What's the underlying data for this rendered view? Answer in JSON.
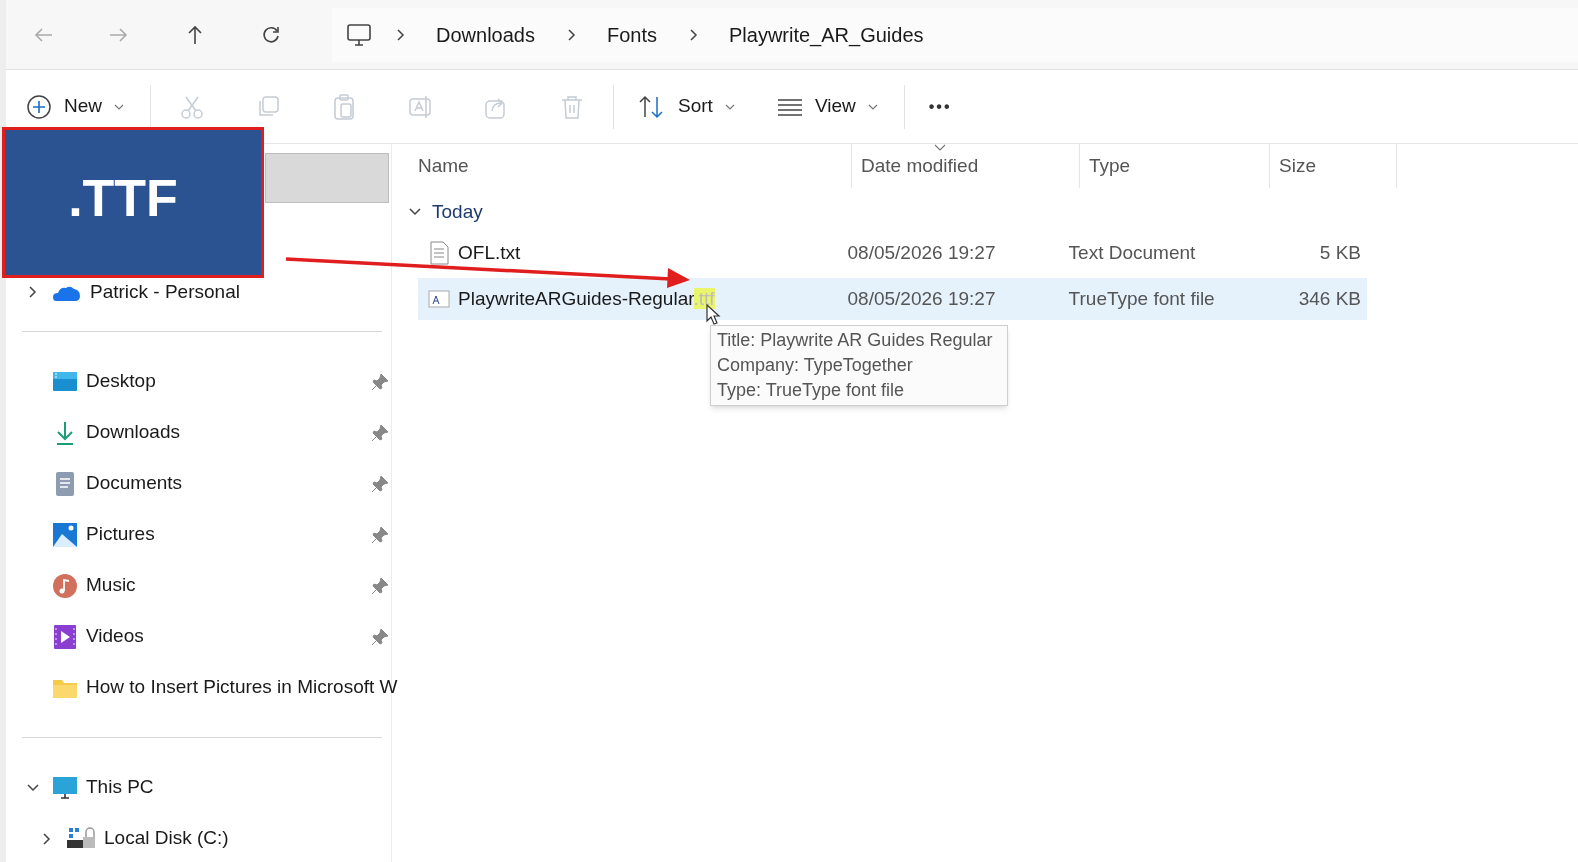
{
  "breadcrumb": [
    "Downloads",
    "Fonts",
    "Playwrite_AR_Guides"
  ],
  "toolbar": {
    "new_label": "New",
    "sort_label": "Sort",
    "view_label": "View",
    "more_label": "•••"
  },
  "overlay_label": ".TTF",
  "sidebar": {
    "account": {
      "label": "Patrick - Personal",
      "expanded": false
    },
    "quick_access": [
      {
        "label": "Desktop",
        "pinned": true
      },
      {
        "label": "Downloads",
        "pinned": true
      },
      {
        "label": "Documents",
        "pinned": true
      },
      {
        "label": "Pictures",
        "pinned": true
      },
      {
        "label": "Music",
        "pinned": true
      },
      {
        "label": "Videos",
        "pinned": true
      },
      {
        "label": "How to Insert Pictures in Microsoft W",
        "pinned": false
      }
    ],
    "this_pc": {
      "label": "This PC",
      "expanded": true,
      "children": [
        {
          "label": "Local Disk (C:)",
          "expanded": false
        }
      ]
    }
  },
  "table": {
    "columns": [
      "Name",
      "Date modified",
      "Type",
      "Size"
    ],
    "group": {
      "label": "Today",
      "expanded": true
    },
    "rows": [
      {
        "name": "OFL.txt",
        "extension": "",
        "kind": "text",
        "date": "08/05/2026 19:27",
        "type": "Text Document",
        "size": "5 KB",
        "selected": false
      },
      {
        "name": "PlaywriteARGuides-Regular",
        "extension": ".ttf",
        "kind": "font",
        "date": "08/05/2026 19:27",
        "type": "TrueType font file",
        "size": "346 KB",
        "selected": true
      }
    ]
  },
  "tooltip": [
    "Title: Playwrite AR Guides Regular",
    "Company: TypeTogether",
    "Type: TrueType font file"
  ]
}
